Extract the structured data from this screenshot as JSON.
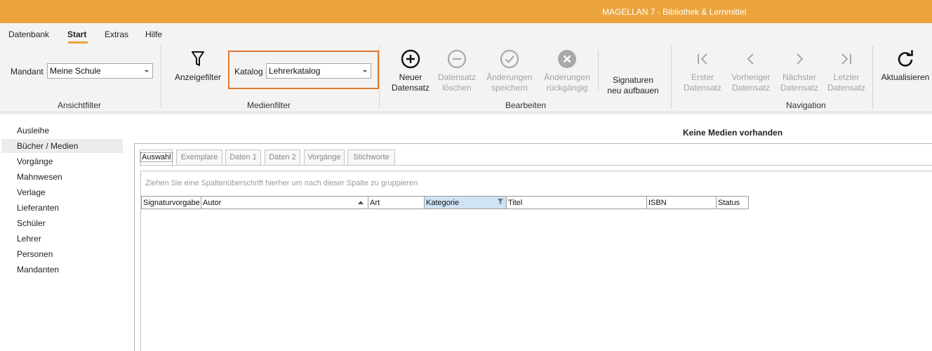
{
  "window": {
    "title": "MAGELLAN 7 - Bibliothek & Lernmittel"
  },
  "menu": {
    "items": [
      "Datenbank",
      "Start",
      "Extras",
      "Hilfe"
    ],
    "active": "Start"
  },
  "ribbon": {
    "ansichtfilter": {
      "label": "Ansichtfilter",
      "mandant_label": "Mandant",
      "mandant_value": "Meine Schule"
    },
    "medienfilter": {
      "label": "Medienfilter",
      "anzeigefilter": "Anzeigefilter",
      "katalog_label": "Katalog",
      "katalog_value": "Lehrerkatalog"
    },
    "bearbeiten": {
      "label": "Bearbeiten",
      "neuer": [
        "Neuer",
        "Datensatz"
      ],
      "loeschen": [
        "Datensatz",
        "löschen"
      ],
      "speichern": [
        "Änderungen",
        "speichern"
      ],
      "rueckgaengig": [
        "Änderungen",
        "rückgängig"
      ],
      "signaturen": [
        "Signaturen",
        "neu aufbauen"
      ]
    },
    "navigation": {
      "label": "Navigation",
      "erster": [
        "Erster",
        "Datensatz"
      ],
      "vorheriger": [
        "Vorheriger",
        "Datensatz"
      ],
      "naechster": [
        "Nächster",
        "Datensatz"
      ],
      "letzter": [
        "Letzter",
        "Datensatz"
      ]
    },
    "aktualisieren": "Aktualisieren"
  },
  "sidebar": {
    "items": [
      "Ausleihe",
      "Bücher / Medien",
      "Vorgänge",
      "Mahnwesen",
      "Verlage",
      "Lieferanten",
      "Schüler",
      "Lehrer",
      "Personen",
      "Mandanten"
    ],
    "selected": "Bücher / Medien"
  },
  "main": {
    "heading": "Keine Medien vorhanden",
    "tabs": [
      "Auswahl",
      "Exemplare",
      "Daten 1",
      "Daten 2",
      "Vorgänge",
      "Stichworte"
    ],
    "active_tab": "Auswahl",
    "group_panel_hint": "Ziehen Sie eine Spaltenüberschrift hierher um nach dieser Spalte zu gruppieren",
    "columns": [
      "Signaturvorgabe",
      "Autor",
      "Art",
      "Kategorie",
      "Titel",
      "ISBN",
      "Status"
    ]
  },
  "colors": {
    "accent": "#eba43c",
    "highlight_border": "#e27b2d",
    "selected_column": "#cfe3f5"
  }
}
